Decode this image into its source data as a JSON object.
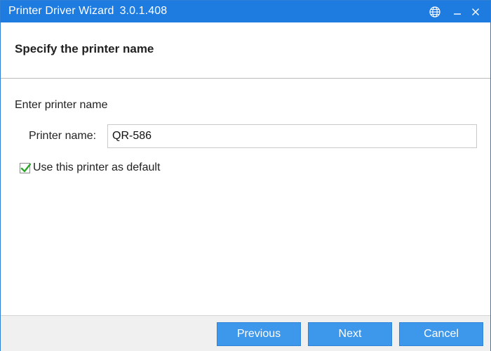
{
  "window": {
    "title": "Printer Driver Wizard",
    "version": "3.0.1.408",
    "controls": [
      {
        "name": "globe-icon",
        "label": ""
      },
      {
        "name": "minimize-icon",
        "label": ""
      },
      {
        "name": "close-icon",
        "label": ""
      }
    ]
  },
  "header": {
    "heading": "Specify the printer name"
  },
  "form": {
    "section_label": "Enter printer name",
    "printer_name_label": "Printer name:",
    "printer_name_value": "QR-586",
    "default_checkbox": {
      "label": "Use this printer as default",
      "checked": true
    }
  },
  "footer": {
    "previous_label": "Previous",
    "next_label": "Next",
    "cancel_label": "Cancel"
  },
  "colors": {
    "titlebar": "#1e7be0",
    "button": "#3d97ea",
    "check": "#2aa62a"
  }
}
